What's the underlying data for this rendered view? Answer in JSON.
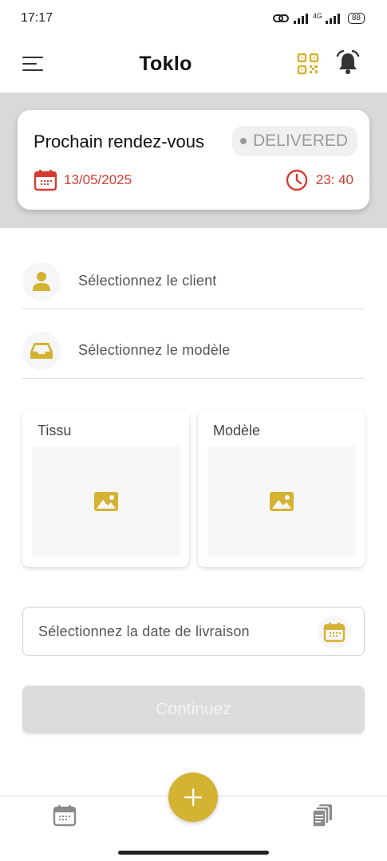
{
  "status_bar": {
    "time": "17:17",
    "network": "4G",
    "battery": "88"
  },
  "header": {
    "title": "Toklo",
    "accent_color": "#d4b232",
    "icons": [
      "menu-icon",
      "qr-code-icon",
      "bell-icon"
    ]
  },
  "appointment": {
    "title": "Prochain rendez-vous",
    "status": "DELIVERED",
    "date": "13/05/2025",
    "time": "23: 40",
    "date_color": "#d63b2f"
  },
  "form": {
    "client_label": "Sélectionnez le client",
    "model_label": "Sélectionnez le modèle",
    "fabric_label": "Tissu",
    "model_image_label": "Modèle",
    "delivery_date_placeholder": "Sélectionnez la date de livraison",
    "continue_label": "Continuez"
  },
  "bottom_nav": {
    "items": [
      "calendar-icon",
      "add-icon",
      "documents-icon"
    ]
  }
}
